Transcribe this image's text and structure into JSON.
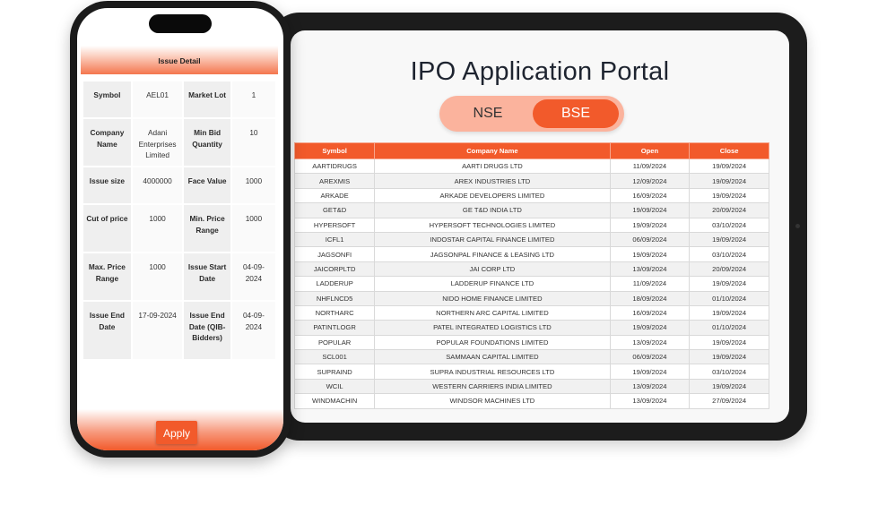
{
  "portal": {
    "title": "IPO Application Portal",
    "toggle": {
      "nse": "NSE",
      "bse": "BSE",
      "selected": "BSE"
    }
  },
  "table": {
    "headers": [
      "Symbol",
      "Company Name",
      "Open",
      "Close"
    ],
    "rows": [
      [
        "AARTIDRUGS",
        "AARTI DRUGS LTD",
        "11/09/2024",
        "19/09/2024"
      ],
      [
        "AREXMIS",
        "AREX INDUSTRIES LTD",
        "12/09/2024",
        "19/09/2024"
      ],
      [
        "ARKADE",
        "ARKADE DEVELOPERS LIMITED",
        "16/09/2024",
        "19/09/2024"
      ],
      [
        "GET&D",
        "GE T&D INDIA LTD",
        "19/09/2024",
        "20/09/2024"
      ],
      [
        "HYPERSOFT",
        "HYPERSOFT TECHNOLOGIES LIMITED",
        "19/09/2024",
        "03/10/2024"
      ],
      [
        "ICFL1",
        "INDOSTAR CAPITAL FINANCE LIMITED",
        "06/09/2024",
        "19/09/2024"
      ],
      [
        "JAGSONFI",
        "JAGSONPAL FINANCE & LEASING LTD",
        "19/09/2024",
        "03/10/2024"
      ],
      [
        "JAICORPLTD",
        "JAI CORP LTD",
        "13/09/2024",
        "20/09/2024"
      ],
      [
        "LADDERUP",
        "LADDERUP FINANCE LTD",
        "11/09/2024",
        "19/09/2024"
      ],
      [
        "NHFLNCD5",
        "NIDO HOME FINANCE LIMITED",
        "18/09/2024",
        "01/10/2024"
      ],
      [
        "NORTHARC",
        "NORTHERN ARC CAPITAL LIMITED",
        "16/09/2024",
        "19/09/2024"
      ],
      [
        "PATINTLOGR",
        "PATEL INTEGRATED LOGISTICS LTD",
        "19/09/2024",
        "01/10/2024"
      ],
      [
        "POPULAR",
        "POPULAR FOUNDATIONS LIMITED",
        "13/09/2024",
        "19/09/2024"
      ],
      [
        "SCL001",
        "SAMMAAN CAPITAL LIMITED",
        "06/09/2024",
        "19/09/2024"
      ],
      [
        "SUPRAIND",
        "SUPRA INDUSTRIAL RESOURCES LTD",
        "19/09/2024",
        "03/10/2024"
      ],
      [
        "WCIL",
        "WESTERN CARRIERS INDIA LIMITED",
        "13/09/2024",
        "19/09/2024"
      ],
      [
        "WINDMACHIN",
        "WINDSOR MACHINES LTD",
        "13/09/2024",
        "27/09/2024"
      ]
    ]
  },
  "issue": {
    "title": "Issue Detail",
    "rows": [
      [
        {
          "label": "Symbol",
          "value": "AEL01"
        },
        {
          "label": "Market Lot",
          "value": "1"
        }
      ],
      [
        {
          "label": "Company Name",
          "value": "Adani Enterprises Limited"
        },
        {
          "label": "Min Bid Quantity",
          "value": "10"
        }
      ],
      [
        {
          "label": "Issue size",
          "value": "4000000"
        },
        {
          "label": "Face Value",
          "value": "1000"
        }
      ],
      [
        {
          "label": "Cut of price",
          "value": "1000"
        },
        {
          "label": "Min. Price Range",
          "value": "1000"
        }
      ],
      [
        {
          "label": "Max. Price Range",
          "value": "1000"
        },
        {
          "label": "Issue Start Date",
          "value": "04-09-2024"
        }
      ],
      [
        {
          "label": "Issue End Date",
          "value": "17-09-2024"
        },
        {
          "label": "Issue End Date (QIB-Bidders)",
          "value": "04-09-2024"
        }
      ]
    ],
    "apply_label": "Apply"
  },
  "colors": {
    "accent": "#f25a2b",
    "accent_light": "#fbb39d",
    "device": "#1c1c1c"
  }
}
